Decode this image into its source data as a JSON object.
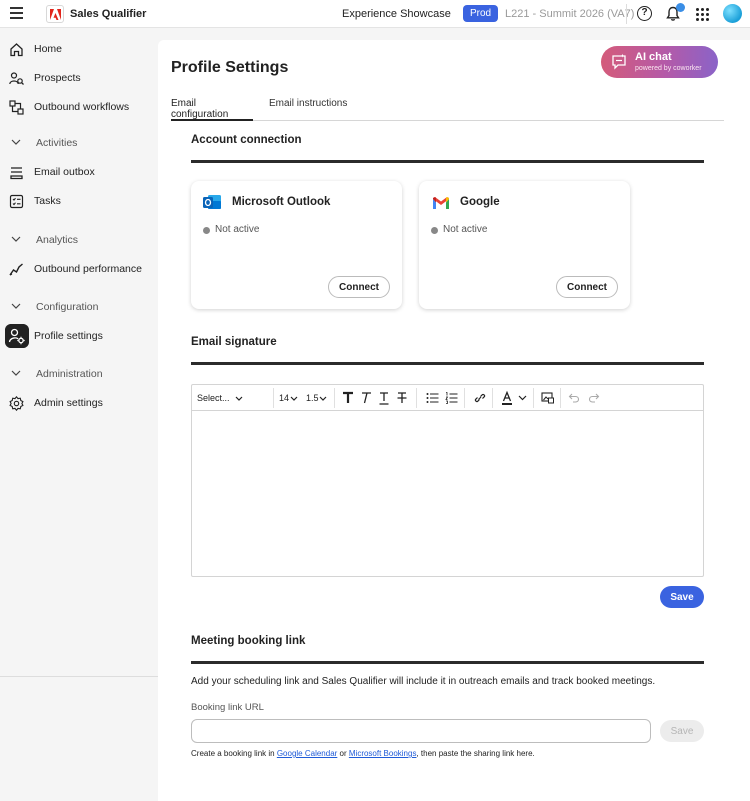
{
  "topbar": {
    "app_title": "Sales Qualifier",
    "showcase": "Experience Showcase",
    "env_badge": "Prod",
    "env_name": "L221 - Summit 2026 (VA7)",
    "help_glyph": "?"
  },
  "sidebar": {
    "items": [
      {
        "label": "Home",
        "icon": "home-icon"
      },
      {
        "label": "Prospects",
        "icon": "prospects-icon"
      },
      {
        "label": "Outbound workflows",
        "icon": "workflows-icon"
      },
      {
        "section": "Activities"
      },
      {
        "label": "Email outbox",
        "icon": "outbox-icon"
      },
      {
        "label": "Tasks",
        "icon": "tasks-icon"
      },
      {
        "section": "Analytics"
      },
      {
        "label": "Outbound performance",
        "icon": "chart-line-icon"
      },
      {
        "section": "Configuration"
      },
      {
        "label": "Profile settings",
        "icon": "profile-settings-icon",
        "active": true
      },
      {
        "section": "Administration"
      },
      {
        "label": "Admin settings",
        "icon": "gear-icon"
      }
    ]
  },
  "main": {
    "page_title": "Profile Settings",
    "ai_chat": {
      "title": "AI chat",
      "subtitle": "powered by coworker"
    },
    "tabs": [
      {
        "label": "Email configuration",
        "active": true
      },
      {
        "label": "Email instructions",
        "active": false
      }
    ],
    "account_connection": {
      "title": "Account connection",
      "providers": [
        {
          "name": "Microsoft Outlook",
          "status": "Not active",
          "button": "Connect"
        },
        {
          "name": "Google",
          "status": "Not active",
          "button": "Connect"
        }
      ]
    },
    "email_signature": {
      "title": "Email signature",
      "font_select": "Select...",
      "font_size": "14",
      "line_height": "1.5",
      "save_label": "Save"
    },
    "meeting_booking": {
      "title": "Meeting booking link",
      "description": "Add your scheduling link and Sales Qualifier will include it in outreach emails and track booked meetings.",
      "url_label": "Booking link URL",
      "url_value": "",
      "save_label": "Save",
      "helper_prefix": "Create a booking link in ",
      "helper_link1": "Google Calendar",
      "helper_mid": " or ",
      "helper_link2": "Microsoft Bookings",
      "helper_suffix": ", then paste the sharing link here."
    }
  },
  "colors": {
    "primary": "#3a63e0",
    "ai_gradient_start": "#d45b7a",
    "ai_gradient_end": "#8a63c8",
    "status_inactive": "#888888"
  }
}
